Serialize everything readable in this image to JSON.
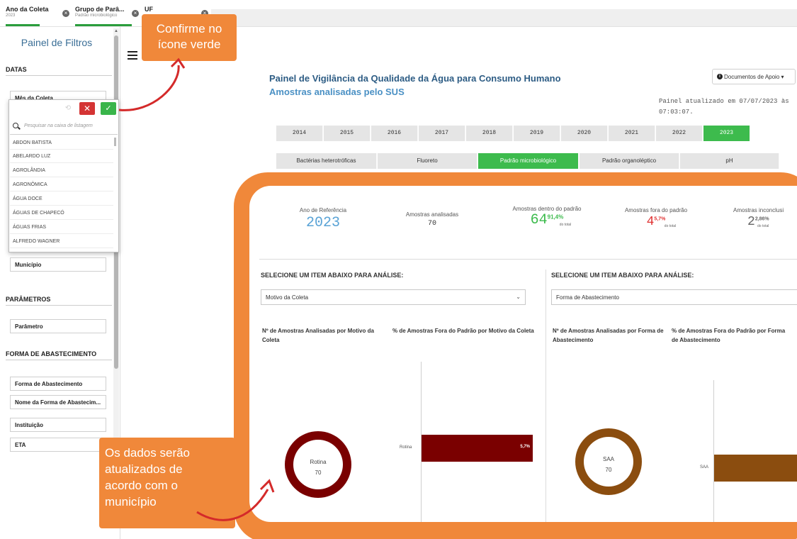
{
  "selection_bar": {
    "chips": [
      {
        "title": "Ano da Coleta",
        "sub": "2023"
      },
      {
        "title": "Grupo de Parâ...",
        "sub": "Padrão microbiológico"
      },
      {
        "title": "UF",
        "sub": ""
      }
    ]
  },
  "filters": {
    "title": "Painel de Filtros",
    "sections": {
      "datas": "DATAS",
      "parametros": "PARÂMETROS",
      "abastecimento": "FORMA DE ABASTECIMENTO"
    },
    "fields": {
      "mes": "Mês da Coleta",
      "municipio": "Município",
      "parametro": "Parâmetro",
      "forma": "Forma de Abastecimento",
      "nome_forma": "Nome da Forma de Abastecim...",
      "instituicao": "Instituição",
      "eta": "ETA"
    },
    "listbox": {
      "search_placeholder": "Pesquisar na caixa de listagem",
      "items": [
        "ABDON BATISTA",
        "ABELARDO LUZ",
        "AGROLÂNDIA",
        "AGRONÔMICA",
        "ÁGUA DOCE",
        "ÁGUAS DE CHAPECÓ",
        "ÁGUAS FRIAS",
        "ALFREDO WAGNER"
      ]
    }
  },
  "header": {
    "title": "Painel de Vigilância da Qualidade da Água para Consumo Humano",
    "subtitle": "Amostras analisadas pelo SUS",
    "docs_button": "Documentos de Apoio ▾",
    "updated_line1": "Painel atualizado em 07/07/2023 às",
    "updated_line2": "07:03:07."
  },
  "years": [
    "2014",
    "2015",
    "2016",
    "2017",
    "2018",
    "2019",
    "2020",
    "2021",
    "2022",
    "2023"
  ],
  "selected_year": "2023",
  "parameters": [
    "Bactérias heterotróficas",
    "Fluoreto",
    "Padrão microbiológico",
    "Padrão organoléptico",
    "pH"
  ],
  "selected_parameter": "Padrão microbiológico",
  "kpis": {
    "ano_label": "Ano de Referência",
    "ano_value": "2023",
    "analisadas_label": "Amostras analisadas",
    "analisadas_value": "70",
    "dentro_label": "Amostras dentro do padrão",
    "dentro_value": "64",
    "dentro_pct": "91,4%",
    "fora_label": "Amostras fora do padrão",
    "fora_value": "4",
    "fora_pct": "5,7%",
    "inconclusivas_label": "Amostras inconclusi",
    "inconclusivas_value": "2",
    "inconclusivas_pct": "2,86%",
    "do_total": "do total"
  },
  "left_analysis": {
    "select_title": "SELECIONE UM ITEM ABAIXO PARA ANÁLISE:",
    "dropdown": "Motivo da Coleta",
    "chart1_title": "Nº de Amostras Analisadas por Motivo da Coleta",
    "chart2_title": "% de Amostras Fora do Padrão por Motivo da Coleta",
    "donut_label": "Rotina",
    "donut_value": "70",
    "bar_label": "Rotina",
    "bar_value": "5,7%"
  },
  "right_analysis": {
    "select_title": "SELECIONE UM ITEM ABAIXO PARA ANÁLISE:",
    "dropdown": "Forma de Abastecimento",
    "chart1_title": "Nº de Amostras Analisadas por Forma de Abastecimento",
    "chart2_title": "% de Amostras Fora do Padrão por Forma de Abastecimento",
    "donut_label": "SAA",
    "donut_value": "70",
    "bar_label": "SAA"
  },
  "callouts": {
    "confirm": "Confirme no ícone verde",
    "update_lines": [
      "Os dados serão",
      "atualizados de",
      "acordo com o",
      "município"
    ]
  },
  "colors": {
    "accent_green": "#3dbb4d",
    "title_blue": "#2d5c84",
    "orange": "#f0883a",
    "dark_red": "#7a0000",
    "brown": "#8b4d0f"
  }
}
